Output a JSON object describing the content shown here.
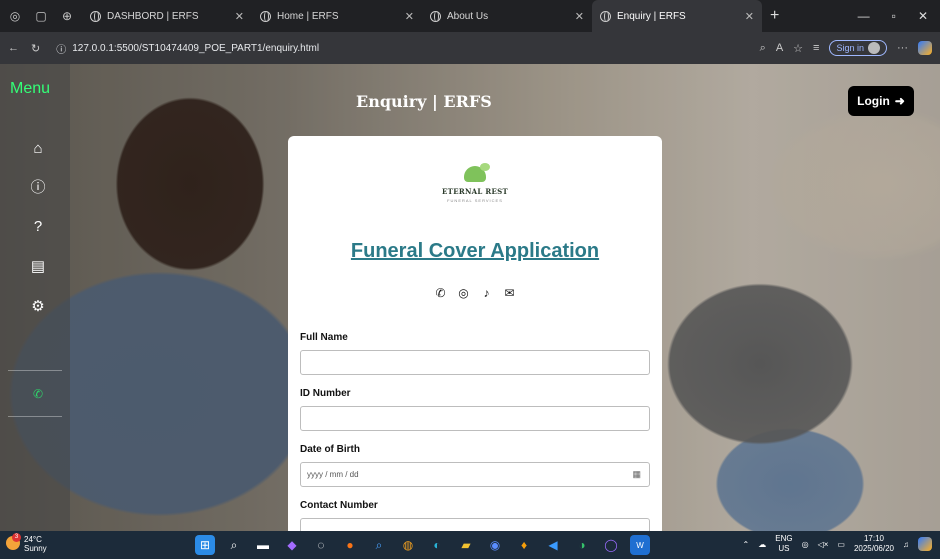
{
  "browser": {
    "tabs": [
      {
        "title": "DASHBORD | ERFS",
        "active": false
      },
      {
        "title": "Home | ERFS",
        "active": false
      },
      {
        "title": "About Us",
        "active": false
      },
      {
        "title": "Enquiry | ERFS",
        "active": true
      }
    ],
    "url": "127.0.0.1:5500/ST10474409_POE_PART1/enquiry.html",
    "sign_in_label": "Sign in"
  },
  "page": {
    "menu_title": "Menu",
    "heading": "Enquiry | ERFS",
    "login_label": "Login",
    "sidebar_icons": [
      "home-icon",
      "info-icon",
      "question-icon",
      "contact-card-icon",
      "settings-icon",
      "whatsapp-icon"
    ]
  },
  "form": {
    "logo_name": "ETERNAL REST",
    "logo_tagline": "FUNERAL SERVICES",
    "title": "Funeral Cover Application",
    "socials": [
      "whatsapp-icon",
      "instagram-icon",
      "tiktok-icon",
      "email-icon"
    ],
    "fields": [
      {
        "label": "Full Name",
        "value": "",
        "placeholder": ""
      },
      {
        "label": "ID Number",
        "value": "",
        "placeholder": ""
      },
      {
        "label": "Date of Birth",
        "value": "",
        "placeholder": "yyyy / mm / dd"
      },
      {
        "label": "Contact Number",
        "value": "",
        "placeholder": ""
      }
    ]
  },
  "taskbar": {
    "weather_temp": "24°C",
    "weather_desc": "Sunny",
    "weather_badge": "3",
    "lang_top": "ENG",
    "lang_bottom": "US",
    "time": "17:10",
    "date": "2025/06/20"
  }
}
